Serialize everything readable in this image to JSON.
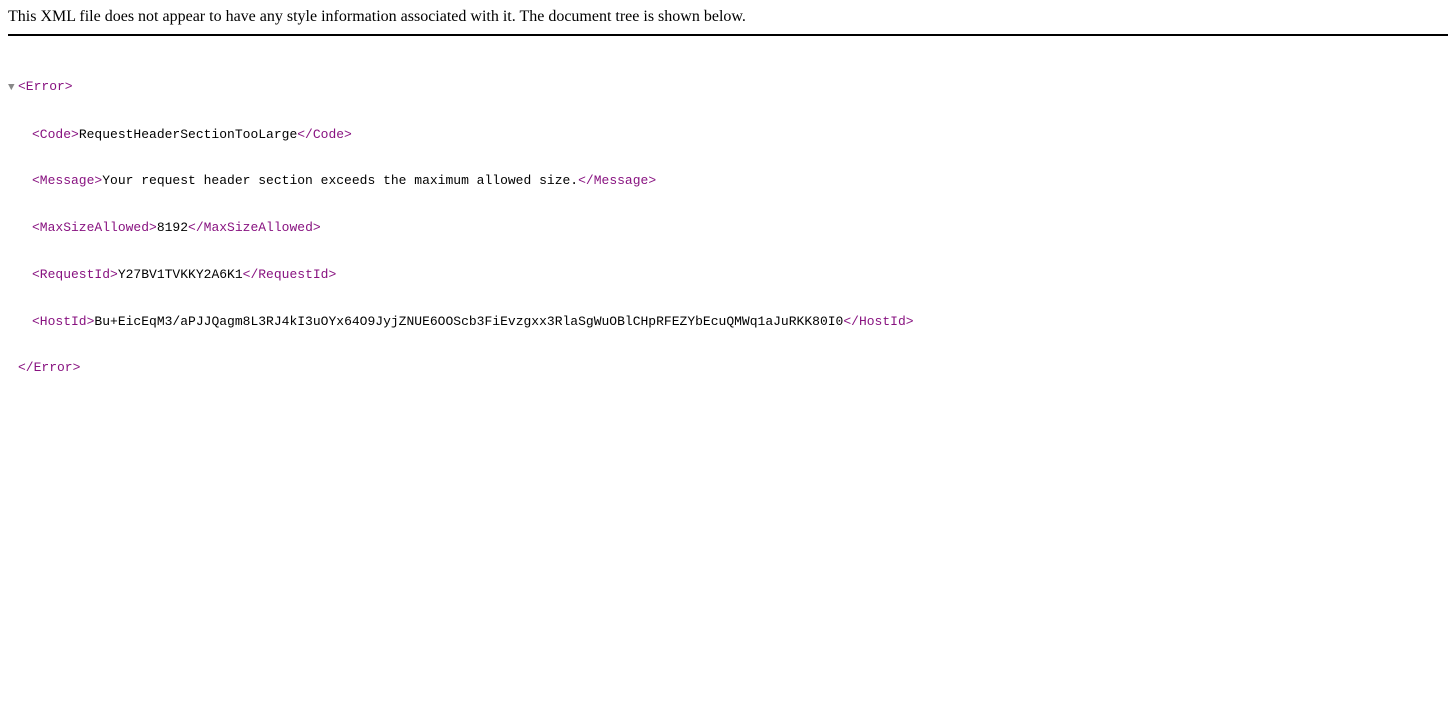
{
  "notice": "This XML file does not appear to have any style information associated with it. The document tree is shown below.",
  "xml": {
    "root_open": "<Error>",
    "root_close": "</Error>",
    "children": [
      {
        "open": "<Code>",
        "value": "RequestHeaderSectionTooLarge",
        "close": "</Code>"
      },
      {
        "open": "<Message>",
        "value": "Your request header section exceeds the maximum allowed size.",
        "close": "</Message>"
      },
      {
        "open": "<MaxSizeAllowed>",
        "value": "8192",
        "close": "</MaxSizeAllowed>"
      },
      {
        "open": "<RequestId>",
        "value": "Y27BV1TVKKY2A6K1",
        "close": "</RequestId>"
      },
      {
        "open": "<HostId>",
        "value": "Bu+EicEqM3/aPJJQagm8L3RJ4kI3uOYx64O9JyjZNUE6OOScb3FiEvzgxx3RlaSgWuOBlCHpRFEZYbEcuQMWq1aJuRKK80I0",
        "close": "</HostId>"
      }
    ]
  },
  "toggle_glyph": "▼"
}
